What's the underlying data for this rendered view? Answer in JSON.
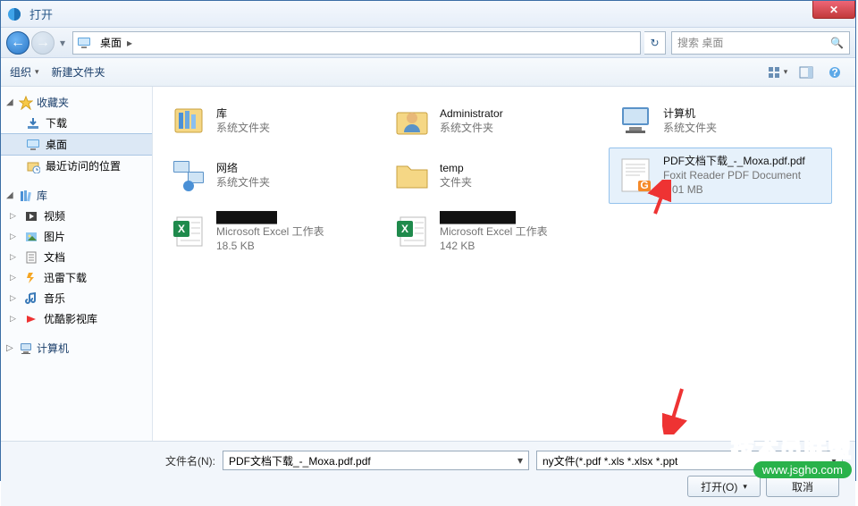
{
  "titlebar": {
    "title": "打开",
    "close_glyph": "✕"
  },
  "nav": {
    "back_glyph": "←",
    "fwd_glyph": "→",
    "split_glyph": "▾",
    "breadcrumb": {
      "root_glyph": "▸",
      "segment": "桌面",
      "arrow": "▸"
    },
    "refresh_glyph": "↻",
    "search_placeholder": "搜索 桌面",
    "search_icon": "🔍"
  },
  "toolbar": {
    "organize": "组织",
    "organize_arrow": "▾",
    "new_folder": "新建文件夹",
    "view_arrow": "▾"
  },
  "sidebar": {
    "favorites": {
      "label": "收藏夹",
      "twisty": "◢",
      "items": [
        {
          "label": "下载",
          "icon": "download"
        },
        {
          "label": "桌面",
          "icon": "desktop",
          "selected": true
        },
        {
          "label": "最近访问的位置",
          "icon": "recent"
        }
      ]
    },
    "libraries": {
      "label": "库",
      "twisty": "◢",
      "items": [
        {
          "label": "视频",
          "icon": "video",
          "twisty": "▷"
        },
        {
          "label": "图片",
          "icon": "picture",
          "twisty": "▷"
        },
        {
          "label": "文档",
          "icon": "document",
          "twisty": "▷"
        },
        {
          "label": "迅雷下载",
          "icon": "xunlei",
          "twisty": "▷"
        },
        {
          "label": "音乐",
          "icon": "music",
          "twisty": "▷"
        },
        {
          "label": "优酷影视库",
          "icon": "youku",
          "twisty": "▷"
        }
      ]
    },
    "computer": {
      "label": "计算机",
      "twisty": "▷"
    }
  },
  "files": [
    {
      "name": "库",
      "type": "系统文件夹",
      "icon": "library-big"
    },
    {
      "name": "Administrator",
      "type": "系统文件夹",
      "icon": "user-folder"
    },
    {
      "name": "计算机",
      "type": "系统文件夹",
      "icon": "computer"
    },
    {
      "name": "网络",
      "type": "系统文件夹",
      "icon": "network"
    },
    {
      "name": "temp",
      "type": "文件夹",
      "icon": "folder"
    },
    {
      "name": "PDF文档下载_-_Moxa.pdf.pdf",
      "type": "Foxit Reader PDF Document",
      "size": "1.01 MB",
      "icon": "pdf",
      "selected": true
    },
    {
      "name": "████████",
      "type": "Microsoft Excel 工作表",
      "size": "18.5 KB",
      "icon": "excel"
    },
    {
      "name": "██████████",
      "type": "Microsoft Excel 工作表",
      "size": "142 KB",
      "icon": "excel"
    }
  ],
  "bottom": {
    "filename_label": "文件名(N):",
    "filename_value": "PDF文档下载_-_Moxa.pdf.pdf",
    "filter_value": "ny文件(*.pdf *.xls *.xlsx *.ppt",
    "open_label": "打开(O)",
    "cancel_label": "取消"
  },
  "watermark": {
    "line1": "技术员联盟",
    "line2": "www.jsgho.com"
  }
}
